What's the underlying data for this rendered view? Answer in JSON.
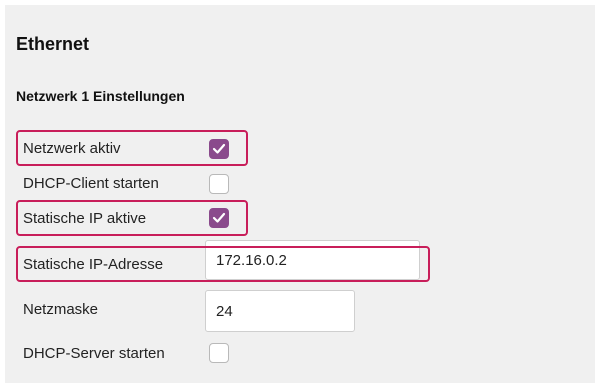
{
  "section": {
    "title": "Ethernet",
    "subtitle": "Netzwerk 1 Einstellungen"
  },
  "fields": {
    "netzwerk_aktiv": {
      "label": "Netzwerk aktiv",
      "checked": true
    },
    "dhcp_client": {
      "label": "DHCP-Client starten",
      "checked": false
    },
    "statische_ip_aktiv": {
      "label": "Statische IP aktive",
      "checked": true
    },
    "statische_ip_adresse": {
      "label": "Statische IP-Adresse",
      "value": "172.16.0.2"
    },
    "netzmaske": {
      "label": "Netzmaske",
      "value": "24"
    },
    "dhcp_server": {
      "label": "DHCP-Server starten",
      "checked": false
    }
  },
  "colors": {
    "checkbox_accent": "#8a4a8c",
    "highlight": "#c81e5a",
    "panel_background": "#f0f0f0"
  },
  "icons": {
    "checked": "checkmark-icon"
  }
}
